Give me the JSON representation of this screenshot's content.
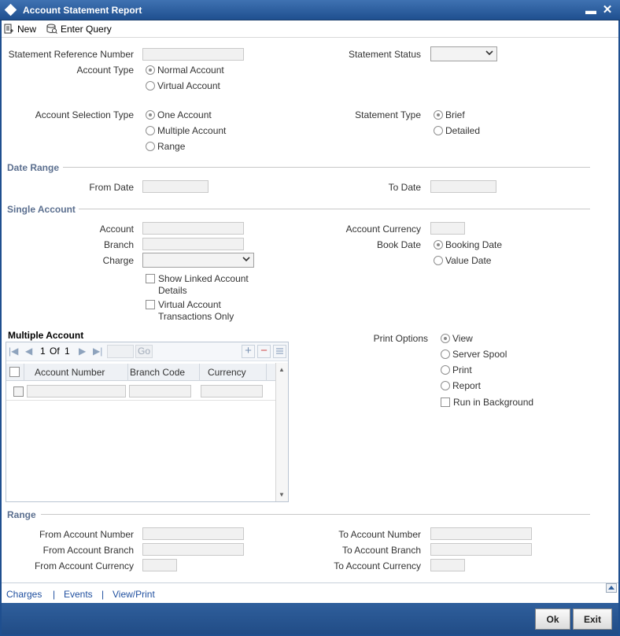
{
  "window": {
    "title": "Account Statement Report"
  },
  "toolbar": {
    "new_label": "New",
    "enter_query_label": "Enter Query"
  },
  "header_fields": {
    "statement_reference_number_label": "Statement Reference Number",
    "statement_status_label": "Statement Status",
    "account_type_label": "Account Type",
    "account_type_options": [
      "Normal Account",
      "Virtual Account"
    ],
    "account_selection_type_label": "Account Selection Type",
    "account_selection_options": [
      "One Account",
      "Multiple Account",
      "Range"
    ],
    "statement_type_label": "Statement Type",
    "statement_type_options": [
      "Brief",
      "Detailed"
    ]
  },
  "date_range": {
    "section_title": "Date Range",
    "from_date_label": "From Date",
    "to_date_label": "To Date"
  },
  "single_account": {
    "section_title": "Single Account",
    "account_label": "Account",
    "branch_label": "Branch",
    "charge_label": "Charge",
    "account_currency_label": "Account Currency",
    "book_date_label": "Book Date",
    "book_date_options": [
      "Booking Date",
      "Value Date"
    ],
    "show_linked_label_1": "Show Linked Account",
    "show_linked_label_2": "Details",
    "virtual_txn_label_1": "Virtual Account",
    "virtual_txn_label_2": "Transactions Only"
  },
  "multiple_account": {
    "section_title": "Multiple Account",
    "pager_current": "1",
    "pager_of": "Of",
    "pager_total": "1",
    "go_label": "Go",
    "columns": [
      "Account Number",
      "Branch Code",
      "Currency"
    ]
  },
  "print_options": {
    "label": "Print Options",
    "options": [
      "View",
      "Server Spool",
      "Print",
      "Report"
    ],
    "run_in_background_label": "Run in Background"
  },
  "range": {
    "section_title": "Range",
    "from_account_number_label": "From Account Number",
    "from_account_branch_label": "From Account Branch",
    "from_account_currency_label": "From Account Currency",
    "to_account_number_label": "To Account Number",
    "to_account_branch_label": "To Account Branch",
    "to_account_currency_label": "To Account Currency"
  },
  "footer": {
    "links": [
      "Charges",
      "Events",
      "View/Print"
    ],
    "separator": "|",
    "ok_label": "Ok",
    "exit_label": "Exit"
  },
  "colors": {
    "title_bar": "#2c5d9c",
    "section_title": "#5b6f8f",
    "link": "#1f4f9f"
  }
}
